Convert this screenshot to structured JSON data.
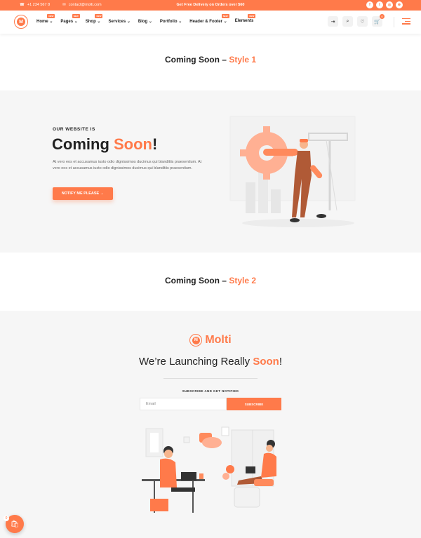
{
  "topbar": {
    "phone": "+1 234 567 8",
    "email": "contact@molti.com",
    "promo": "Get Free Delivery on Orders over $60",
    "social_icons": [
      "facebook-icon",
      "twitter-icon",
      "instagram-icon",
      "dribbble-icon"
    ]
  },
  "header": {
    "logo_letter": "M",
    "nav": [
      {
        "label": "Home",
        "badge": "NEW"
      },
      {
        "label": "Pages",
        "badge": "NEW"
      },
      {
        "label": "Shop",
        "badge": "NEW"
      },
      {
        "label": "Services",
        "badge": ""
      },
      {
        "label": "Blog",
        "badge": ""
      },
      {
        "label": "Portfolio",
        "badge": ""
      },
      {
        "label": "Header & Footer",
        "badge": "NEW"
      },
      {
        "label": "Elements",
        "badge": "NEW"
      }
    ],
    "cart_count": "0"
  },
  "style1": {
    "title_main": "Coming Soon – ",
    "title_accent": "Style 1",
    "eyebrow": "OUR WEBSITE IS",
    "heading_a": "Coming ",
    "heading_b": "Soon",
    "heading_c": "!",
    "paragraph": "At vero eos et accusamus iusto odio dignissimos ducimus qui blanditiis praesentium. At vero eos et accusamus iusto odio dignissimos ducimus qui blanditiis praesentium.",
    "button": "NOTIFY ME PLEASE →"
  },
  "style2": {
    "title_main": "Coming Soon – ",
    "title_accent": "Style 2",
    "brand": "Molti",
    "launch_a": "We’re Launching Really ",
    "launch_b": "Soon",
    "launch_c": "!",
    "subscribe_label": "SUBSCRIBE AND GET NOTIFIED",
    "email_placeholder": "Email",
    "subscribe_button": "SUBSCRIBE"
  },
  "fab": {
    "count": "0"
  },
  "colors": {
    "accent": "#ff7a4a",
    "section_bg": "#f6f6f6"
  }
}
